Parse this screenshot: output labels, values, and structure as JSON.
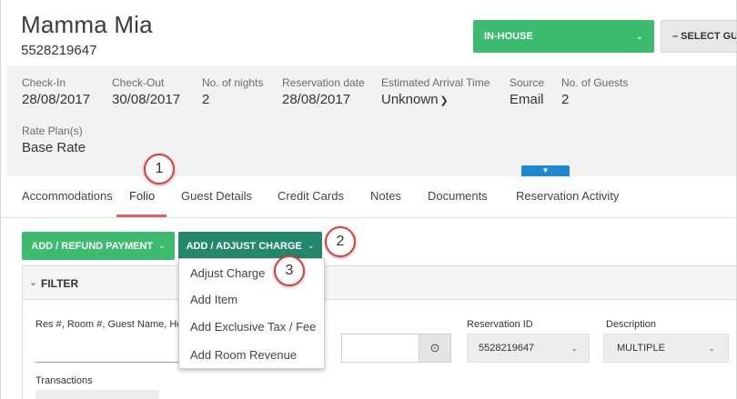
{
  "header": {
    "guest_name": "Mamma Mia",
    "reservation_number": "5528219647",
    "status_label": "IN-HOUSE",
    "guest_select_label": "– SELECT GU"
  },
  "info": {
    "checkin": {
      "label": "Check-In",
      "value": "28/08/2017"
    },
    "checkout": {
      "label": "Check-Out",
      "value": "30/08/2017"
    },
    "nights": {
      "label": "No. of nights",
      "value": "2"
    },
    "resdate": {
      "label": "Reservation date",
      "value": "28/08/2017"
    },
    "eta": {
      "label": "Estimated Arrival Time",
      "value": "Unknown"
    },
    "source": {
      "label": "Source",
      "value": "Email"
    },
    "guests": {
      "label": "No. of Guests",
      "value": "2"
    },
    "rateplan": {
      "label": "Rate Plan(s)",
      "value": "Base Rate"
    }
  },
  "tabs": [
    {
      "label": "Accommodations"
    },
    {
      "label": "Folio",
      "active": true
    },
    {
      "label": "Guest Details"
    },
    {
      "label": "Credit Cards"
    },
    {
      "label": "Notes"
    },
    {
      "label": "Documents"
    },
    {
      "label": "Reservation Activity"
    }
  ],
  "actions": {
    "payment_label": "ADD / REFUND PAYMENT",
    "charge_label": "ADD / ADJUST CHARGE"
  },
  "charge_menu": [
    "Adjust Charge",
    "Add Item",
    "Add Exclusive Tax / Fee",
    "Add Room Revenue"
  ],
  "filter": {
    "title": "FILTER",
    "search_label": "Res #, Room #, Guest Name, Ho",
    "reservation_id_label": "Reservation ID",
    "reservation_id_value": "5528219647",
    "description_label": "Description",
    "description_value": "MULTIPLE",
    "transactions_label": "Transactions"
  },
  "markers": [
    "1",
    "2",
    "3"
  ],
  "colors": {
    "status_green": "#3dbb6f",
    "charge_teal": "#23876c",
    "tab_underline": "#e95b6a",
    "expand_blue": "#1e88d0",
    "marker_red": "#e03a3a"
  }
}
